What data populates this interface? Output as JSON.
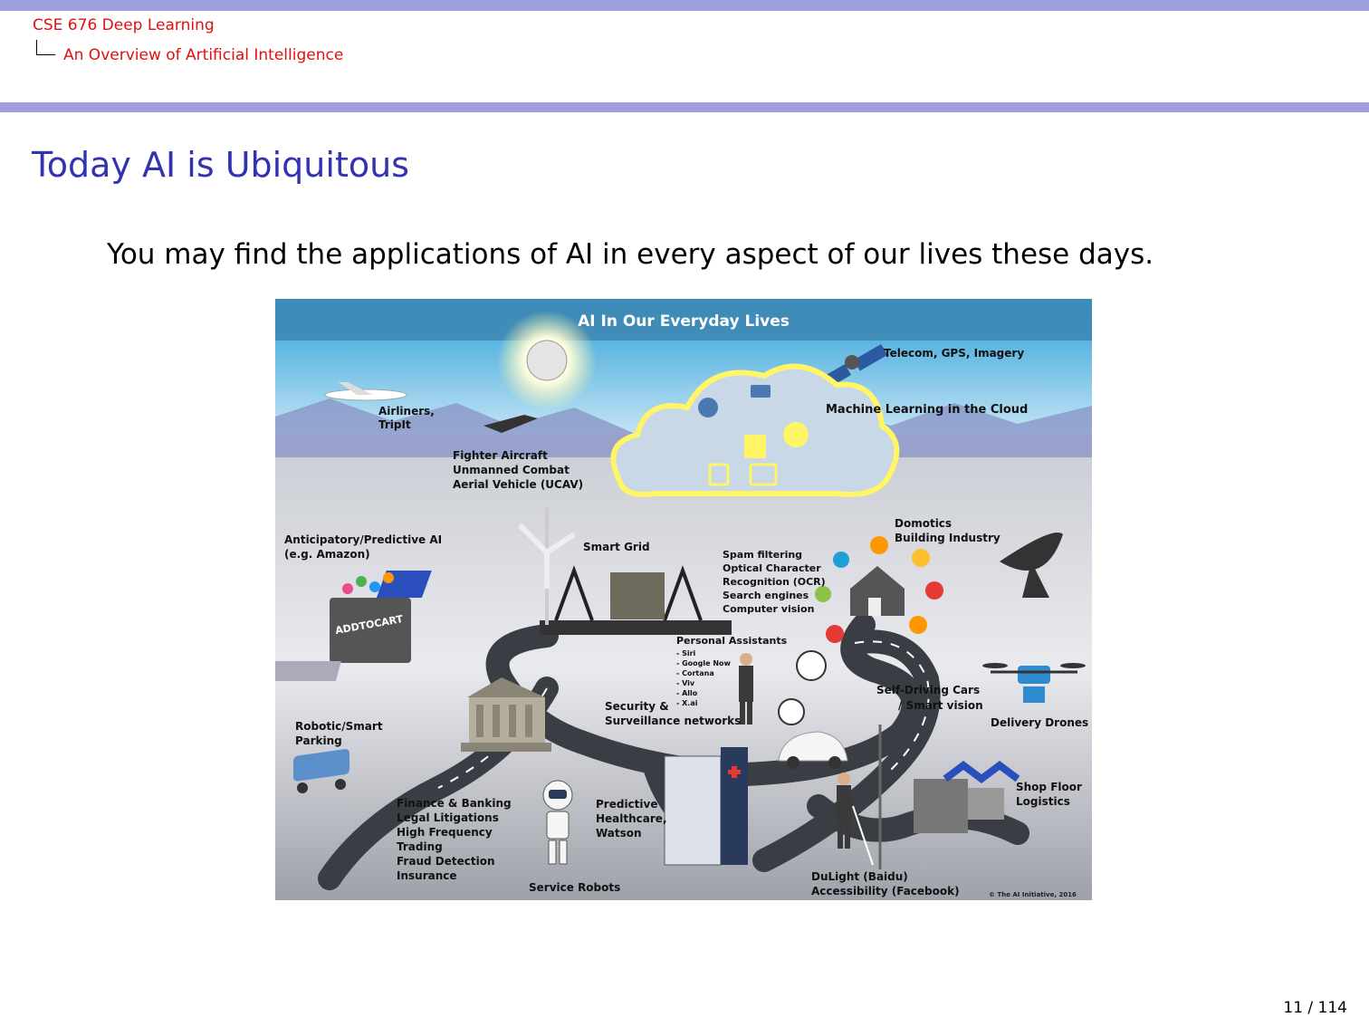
{
  "header": {
    "course_title": "CSE 676 Deep Learning",
    "section_title": "An Overview of Artificial Intelligence"
  },
  "slide": {
    "title": "Today AI is Ubiquitous",
    "body": "You may find the applications of AI in every aspect of our lives these days."
  },
  "illustration": {
    "banner": "AI In Our Everyday Lives",
    "copyright": "© The AI Initiative, 2016",
    "labels": {
      "telecom": "Telecom, GPS, Imagery",
      "ml_cloud": "Machine Learning in the Cloud",
      "airliners_1": "Airliners,",
      "airliners_2": "TripIt",
      "fighter_1": "Fighter Aircraft",
      "fighter_2": "Unmanned Combat",
      "fighter_3": "Aerial Vehicle (UCAV)",
      "anticipatory_1": "Anticipatory/Predictive AI",
      "anticipatory_2": "(e.g. Amazon)",
      "smart_grid": "Smart Grid",
      "domotics_1": "Domotics",
      "domotics_2": "Building Industry",
      "spam_1": "Spam filtering",
      "spam_2": "Optical Character",
      "spam_3": "Recognition (OCR)",
      "spam_4": "Search engines",
      "spam_5": "Computer vision",
      "assistants_title": "Personal Assistants",
      "assistant_1": "- Siri",
      "assistant_2": "- Google Now",
      "assistant_3": "- Cortana",
      "assistant_4": "- Viv",
      "assistant_5": "- Allo",
      "assistant_6": "- X.ai",
      "self_driving_1": "Self-Driving Cars",
      "self_driving_2": "/ Smart vision",
      "delivery_drones": "Delivery Drones",
      "security_1": "Security &",
      "security_2": "Surveillance networks",
      "robotic_parking_1": "Robotic/Smart",
      "robotic_parking_2": "Parking",
      "shop_floor_1": "Shop Floor",
      "shop_floor_2": "Logistics",
      "finance_1": "Finance & Banking",
      "finance_2": "Legal Litigations",
      "finance_3": "High Frequency",
      "finance_4": "Trading",
      "finance_5": "Fraud Detection",
      "finance_6": "Insurance",
      "healthcare_1": "Predictive",
      "healthcare_2": "Healthcare,",
      "healthcare_3": "Watson",
      "service_robots": "Service Robots",
      "dulight_1": "DuLight (Baidu)",
      "dulight_2": "Accessibility (Facebook)",
      "laptop_screen": "ADDTOCART"
    }
  },
  "footer": {
    "page_number": "11 / 114"
  }
}
